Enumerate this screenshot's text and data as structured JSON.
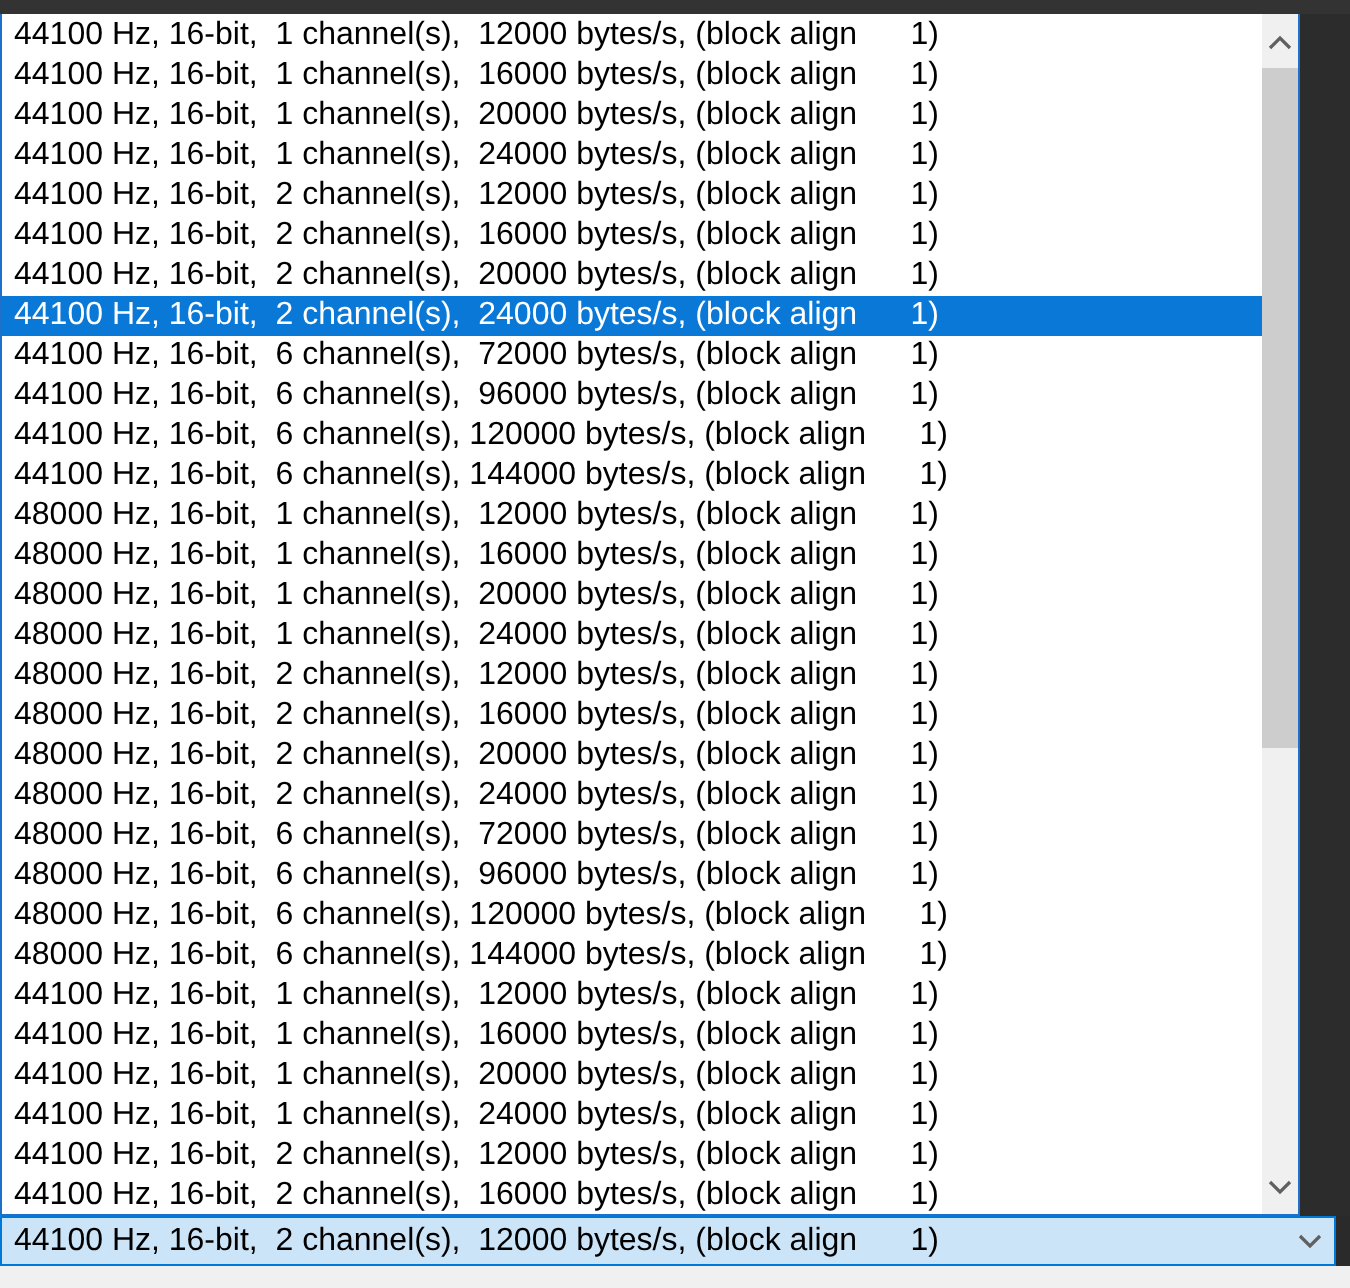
{
  "list": {
    "items": [
      {
        "text": "44100 Hz, 16-bit,  1 channel(s),  12000 bytes/s, (block align      1)",
        "selected": false
      },
      {
        "text": "44100 Hz, 16-bit,  1 channel(s),  16000 bytes/s, (block align      1)",
        "selected": false
      },
      {
        "text": "44100 Hz, 16-bit,  1 channel(s),  20000 bytes/s, (block align      1)",
        "selected": false
      },
      {
        "text": "44100 Hz, 16-bit,  1 channel(s),  24000 bytes/s, (block align      1)",
        "selected": false
      },
      {
        "text": "44100 Hz, 16-bit,  2 channel(s),  12000 bytes/s, (block align      1)",
        "selected": false
      },
      {
        "text": "44100 Hz, 16-bit,  2 channel(s),  16000 bytes/s, (block align      1)",
        "selected": false
      },
      {
        "text": "44100 Hz, 16-bit,  2 channel(s),  20000 bytes/s, (block align      1)",
        "selected": false
      },
      {
        "text": "44100 Hz, 16-bit,  2 channel(s),  24000 bytes/s, (block align      1)",
        "selected": true
      },
      {
        "text": "44100 Hz, 16-bit,  6 channel(s),  72000 bytes/s, (block align      1)",
        "selected": false
      },
      {
        "text": "44100 Hz, 16-bit,  6 channel(s),  96000 bytes/s, (block align      1)",
        "selected": false
      },
      {
        "text": "44100 Hz, 16-bit,  6 channel(s), 120000 bytes/s, (block align      1)",
        "selected": false
      },
      {
        "text": "44100 Hz, 16-bit,  6 channel(s), 144000 bytes/s, (block align      1)",
        "selected": false
      },
      {
        "text": "48000 Hz, 16-bit,  1 channel(s),  12000 bytes/s, (block align      1)",
        "selected": false
      },
      {
        "text": "48000 Hz, 16-bit,  1 channel(s),  16000 bytes/s, (block align      1)",
        "selected": false
      },
      {
        "text": "48000 Hz, 16-bit,  1 channel(s),  20000 bytes/s, (block align      1)",
        "selected": false
      },
      {
        "text": "48000 Hz, 16-bit,  1 channel(s),  24000 bytes/s, (block align      1)",
        "selected": false
      },
      {
        "text": "48000 Hz, 16-bit,  2 channel(s),  12000 bytes/s, (block align      1)",
        "selected": false
      },
      {
        "text": "48000 Hz, 16-bit,  2 channel(s),  16000 bytes/s, (block align      1)",
        "selected": false
      },
      {
        "text": "48000 Hz, 16-bit,  2 channel(s),  20000 bytes/s, (block align      1)",
        "selected": false
      },
      {
        "text": "48000 Hz, 16-bit,  2 channel(s),  24000 bytes/s, (block align      1)",
        "selected": false
      },
      {
        "text": "48000 Hz, 16-bit,  6 channel(s),  72000 bytes/s, (block align      1)",
        "selected": false
      },
      {
        "text": "48000 Hz, 16-bit,  6 channel(s),  96000 bytes/s, (block align      1)",
        "selected": false
      },
      {
        "text": "48000 Hz, 16-bit,  6 channel(s), 120000 bytes/s, (block align      1)",
        "selected": false
      },
      {
        "text": "48000 Hz, 16-bit,  6 channel(s), 144000 bytes/s, (block align      1)",
        "selected": false
      },
      {
        "text": "44100 Hz, 16-bit,  1 channel(s),  12000 bytes/s, (block align      1)",
        "selected": false
      },
      {
        "text": "44100 Hz, 16-bit,  1 channel(s),  16000 bytes/s, (block align      1)",
        "selected": false
      },
      {
        "text": "44100 Hz, 16-bit,  1 channel(s),  20000 bytes/s, (block align      1)",
        "selected": false
      },
      {
        "text": "44100 Hz, 16-bit,  1 channel(s),  24000 bytes/s, (block align      1)",
        "selected": false
      },
      {
        "text": "44100 Hz, 16-bit,  2 channel(s),  12000 bytes/s, (block align      1)",
        "selected": false
      },
      {
        "text": "44100 Hz, 16-bit,  2 channel(s),  16000 bytes/s, (block align      1)",
        "selected": false
      }
    ]
  },
  "combo": {
    "value": "44100 Hz, 16-bit,  2 channel(s),  12000 bytes/s, (block align      1)",
    "expanded": true
  }
}
